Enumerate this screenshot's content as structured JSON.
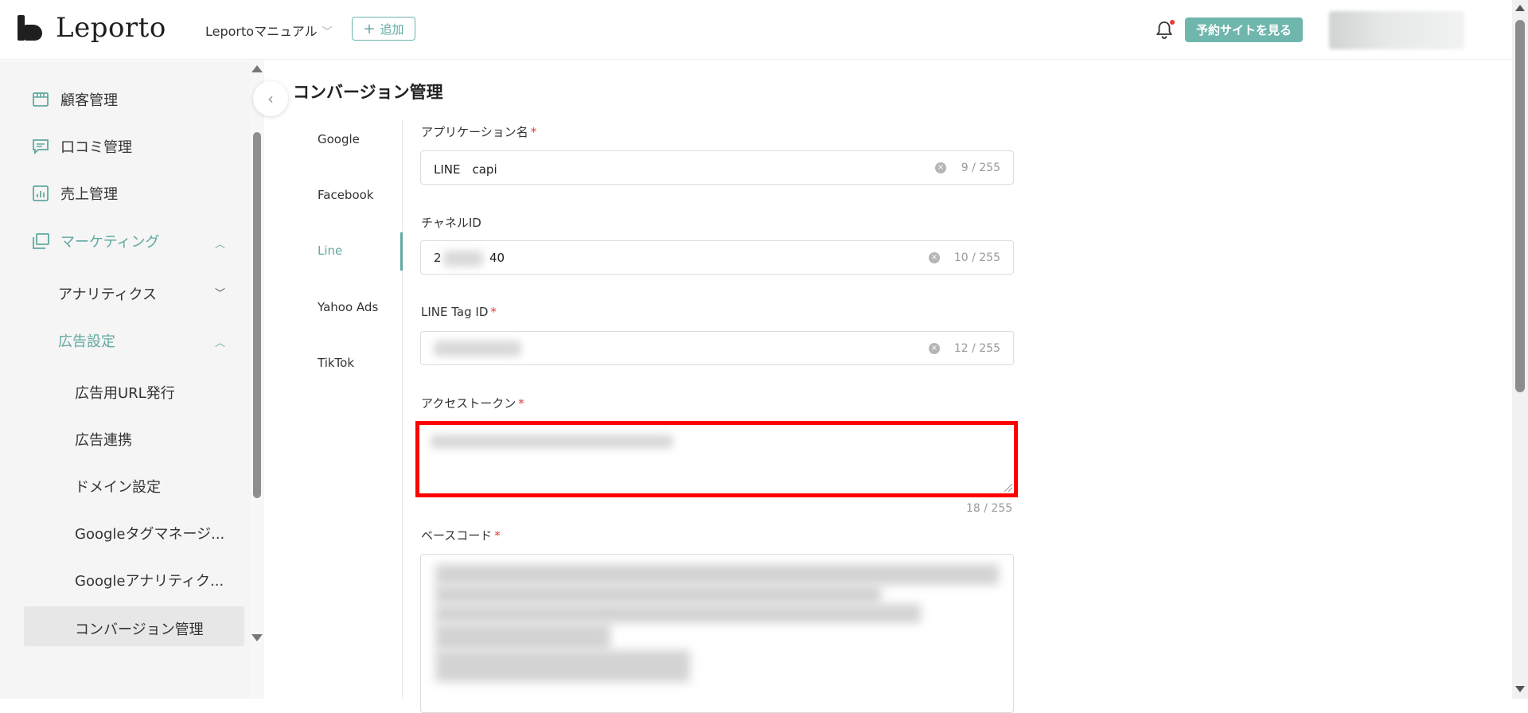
{
  "header": {
    "logo_text": "Leporto",
    "project_name": "Leportoマニュアル",
    "add_label": "追加",
    "view_site_label": "予約サイトを見る",
    "notification_badge_color": "#e53935",
    "accent_color": "#6fb6ad"
  },
  "sidebar": {
    "items": [
      {
        "label": "顧客管理",
        "icon": "storefront-icon"
      },
      {
        "label": "口コミ管理",
        "icon": "comment-icon"
      },
      {
        "label": "売上管理",
        "icon": "chart-icon"
      },
      {
        "label": "マーケティング",
        "icon": "layers-icon",
        "expanded": true
      },
      {
        "label": "アナリティクス",
        "expanded": false
      },
      {
        "label": "広告設定",
        "expanded": true
      },
      {
        "label": "広告用URL発行"
      },
      {
        "label": "広告連携"
      },
      {
        "label": "ドメイン設定"
      },
      {
        "label": "Googleタグマネージ..."
      },
      {
        "label": "Googleアナリティク..."
      },
      {
        "label": "コンバージョン管理",
        "active": true
      }
    ]
  },
  "main": {
    "title": "コンバージョン管理",
    "tabs": [
      "Google",
      "Facebook",
      "Line",
      "Yahoo Ads",
      "TikTok"
    ],
    "active_tab": "Line",
    "fields": {
      "app_name": {
        "label": "アプリケーション名",
        "value": "LINE　capi",
        "count": "9 / 255"
      },
      "channel_id": {
        "label": "チャネルID",
        "value_start": "2",
        "value_end": "40",
        "count": "10 / 255"
      },
      "line_tag_id": {
        "label": "LINE Tag ID",
        "count": "12 / 255"
      },
      "access_token": {
        "label": "アクセストークン",
        "count": "18 / 255"
      },
      "base_code": {
        "label": "ベースコード"
      }
    },
    "required_mark": "*"
  }
}
